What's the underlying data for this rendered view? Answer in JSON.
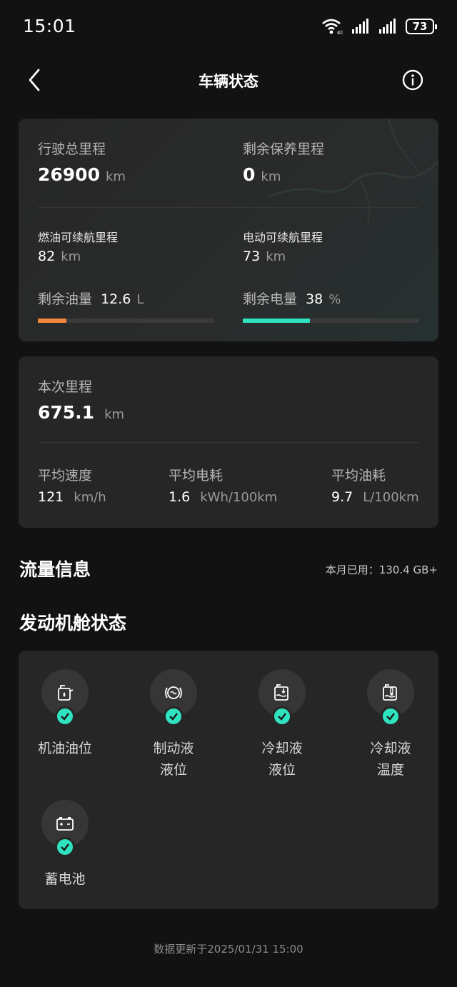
{
  "status_bar": {
    "time": "15:01",
    "battery": "73"
  },
  "header": {
    "title": "车辆状态"
  },
  "mileage_card": {
    "total_label": "行驶总里程",
    "total_value": "26900",
    "total_unit": "km",
    "maint_label": "剩余保养里程",
    "maint_value": "0",
    "maint_unit": "km",
    "fuel_range_label": "燃油可续航里程",
    "fuel_range_value": "82",
    "fuel_range_unit": "km",
    "ev_range_label": "电动可续航里程",
    "ev_range_value": "73",
    "ev_range_unit": "km",
    "fuel_label": "剩余油量",
    "fuel_value": "12.6",
    "fuel_unit": "L",
    "fuel_fraction": 0.16,
    "battery_label": "剩余电量",
    "battery_value": "38",
    "battery_unit": "%",
    "battery_fraction": 0.38
  },
  "trip_card": {
    "trip_label": "本次里程",
    "trip_value": "675.1",
    "trip_unit": "km",
    "speed_label": "平均速度",
    "speed_value": "121",
    "speed_unit": "km/h",
    "elec_label": "平均电耗",
    "elec_value": "1.6",
    "elec_unit": "kWh/100km",
    "oil_label": "平均油耗",
    "oil_value": "9.7",
    "oil_unit": "L/100km"
  },
  "traffic": {
    "title": "流量信息",
    "used": "本月已用：130.4 GB+"
  },
  "engine": {
    "title": "发动机舱状态",
    "items": [
      {
        "line1": "机油油位",
        "line2": ""
      },
      {
        "line1": "制动液",
        "line2": "液位"
      },
      {
        "line1": "冷却液",
        "line2": "液位"
      },
      {
        "line1": "冷却液",
        "line2": "温度"
      },
      {
        "line1": "蓄电池",
        "line2": ""
      }
    ]
  },
  "footer": {
    "updated": "数据更新于2025/01/31 15:00"
  },
  "colors": {
    "fuel_bar": "#f5873b",
    "battery_bar": "#2fe3c0",
    "check": "#2fe3c0"
  }
}
